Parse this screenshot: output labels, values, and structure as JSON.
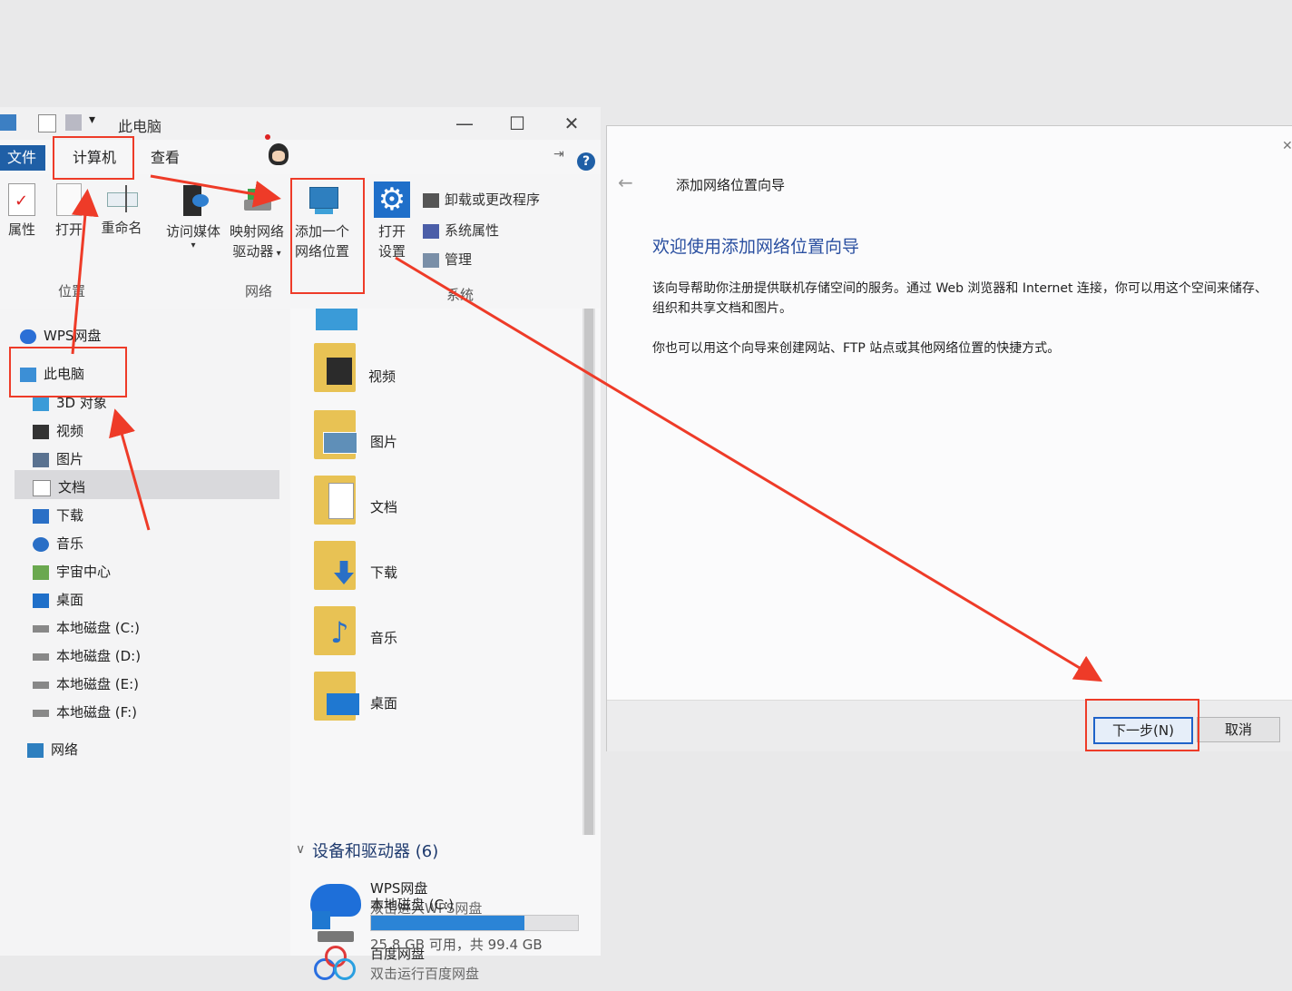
{
  "explorer": {
    "title": "此电脑",
    "window_controls": {
      "minimize": "—",
      "maximize": "☐",
      "close": "✕"
    },
    "menu_tabs": {
      "file": "文件",
      "computer": "计算机",
      "view": "查看"
    },
    "help": "?",
    "ribbon": {
      "location": {
        "properties": "属性",
        "open": "打开",
        "rename": "重命名",
        "group": "位置"
      },
      "network": {
        "access_media": "访问媒体",
        "map_drive_l1": "映射网络",
        "map_drive_l2": "驱动器",
        "add_location_l1": "添加一个",
        "add_location_l2": "网络位置",
        "group": "网络"
      },
      "system": {
        "open_settings_l1": "打开",
        "open_settings_l2": "设置",
        "uninstall": "卸载或更改程序",
        "system_properties": "系统属性",
        "manage": "管理",
        "group": "系统"
      }
    },
    "nav": {
      "wps": "WPS网盘",
      "this_pc": "此电脑",
      "items": [
        "3D 对象",
        "视频",
        "图片",
        "文档",
        "下载",
        "音乐",
        "宇宙中心",
        "桌面",
        "本地磁盘 (C:)",
        "本地磁盘 (D:)",
        "本地磁盘 (E:)",
        "本地磁盘 (F:)"
      ],
      "network": "网络"
    },
    "folders": [
      "视频",
      "图片",
      "文档",
      "下载",
      "音乐",
      "桌面"
    ],
    "devices_header": "设备和驱动器 (6)",
    "devices": [
      {
        "name": "WPS网盘",
        "desc": "双击进入WPS网盘"
      },
      {
        "name": "百度网盘",
        "desc": "双击运行百度网盘"
      }
    ],
    "drive_c": {
      "name": "本地磁盘 (C:)",
      "free": "25.8 GB 可用，共 99.4 GB",
      "used_fraction": 0.74
    }
  },
  "wizard": {
    "title": "添加网络位置向导",
    "heading": "欢迎使用添加网络位置向导",
    "para1": "该向导帮助你注册提供联机存储空间的服务。通过 Web 浏览器和 Internet 连接，你可以用这个空间来储存、组织和共享文档和图片。",
    "para2": "你也可以用这个向导来创建网站、FTP 站点或其他网络位置的快捷方式。",
    "next": "下一步(N)",
    "cancel": "取消"
  },
  "colors": {
    "annotation": "#ee3b28",
    "accent": "#1f5fa6",
    "wizard_heading": "#2a4fa0"
  }
}
